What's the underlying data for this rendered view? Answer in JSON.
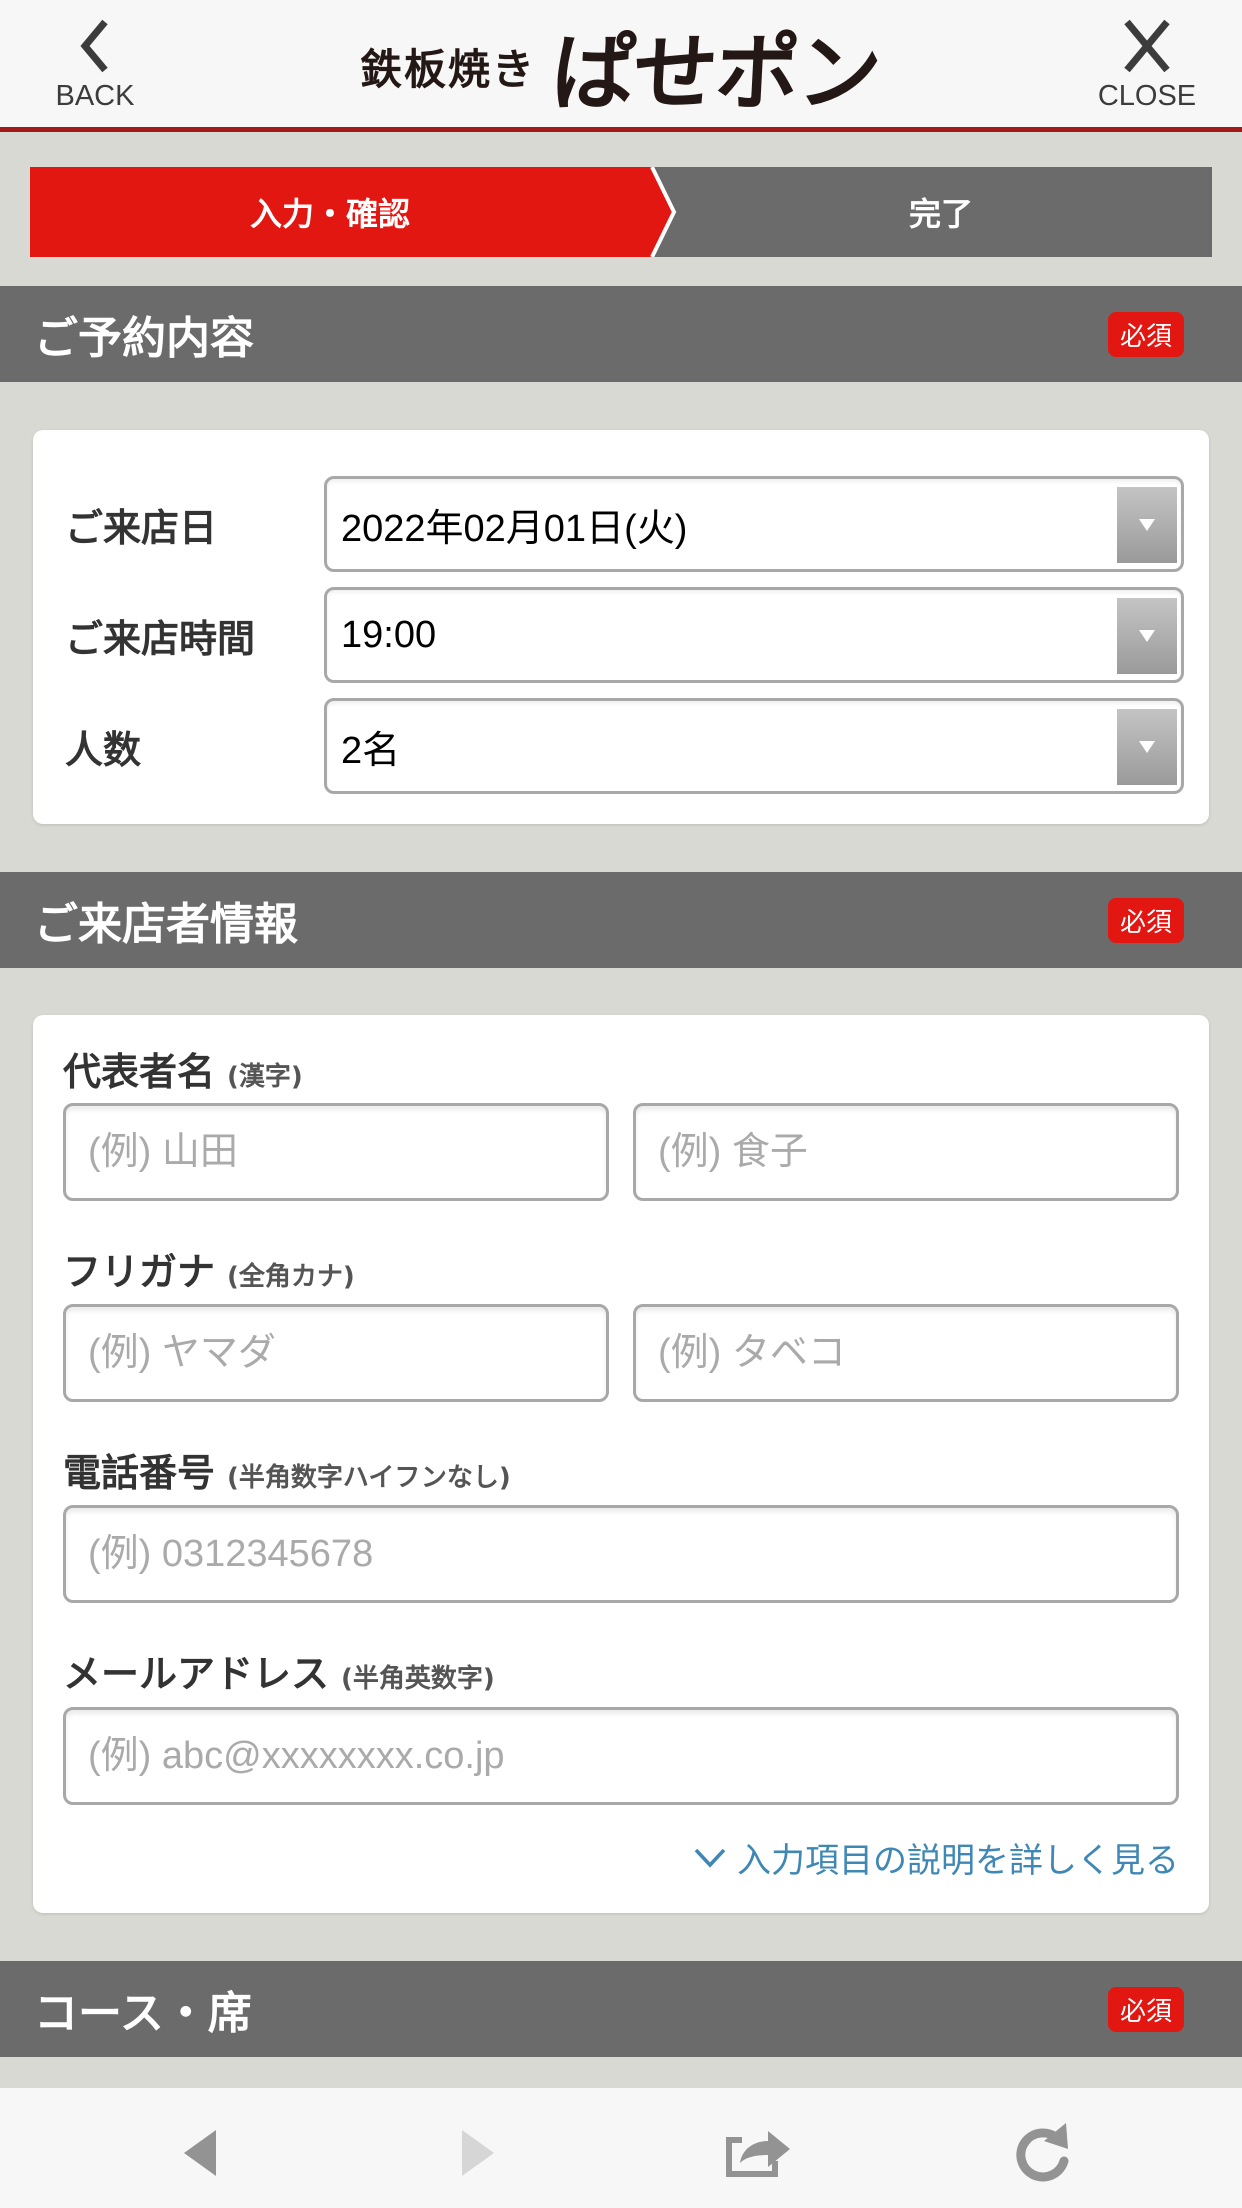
{
  "header": {
    "back_label": "BACK",
    "close_label": "CLOSE",
    "logo_sub": "鉄板焼き",
    "logo_main": "ぱせポン"
  },
  "steps": [
    {
      "label": "入力・確認",
      "state": "active"
    },
    {
      "label": "完了",
      "state": "pending"
    }
  ],
  "colors": {
    "accent_red": "#e31712",
    "header_border": "#a31a1a",
    "section_gray": "#6b6b6b",
    "link_blue": "#3f87b5",
    "page_bg": "#d9d9d3"
  },
  "sections": {
    "reservation": {
      "title": "ご予約内容",
      "badge": "必須",
      "fields": [
        {
          "label": "ご来店日",
          "value": "2022年02月01日(火)"
        },
        {
          "label": "ご来店時間",
          "value": "19:00"
        },
        {
          "label": "人数",
          "value": "2名"
        }
      ]
    },
    "visitor": {
      "title": "ご来店者情報",
      "badge": "必須",
      "name": {
        "label": "代表者名",
        "hint": "(漢字)",
        "last_placeholder": "(例) 山田",
        "first_placeholder": "(例) 食子"
      },
      "furigana": {
        "label": "フリガナ",
        "hint": "(全角カナ)",
        "last_placeholder": "(例) ヤマダ",
        "first_placeholder": "(例) タベコ"
      },
      "phone": {
        "label": "電話番号",
        "hint": "(半角数字ハイフンなし)",
        "placeholder": "(例) 0312345678"
      },
      "email": {
        "label": "メールアドレス",
        "hint": "(半角英数字)",
        "placeholder": "(例) abc@xxxxxxxx.co.jp"
      },
      "details_link": "入力項目の説明を詳しく見る"
    },
    "course": {
      "title": "コース・席",
      "badge": "必須"
    }
  },
  "toolbar": {
    "icons": [
      "back-arrow-icon",
      "forward-arrow-icon",
      "share-icon",
      "reload-icon"
    ]
  }
}
